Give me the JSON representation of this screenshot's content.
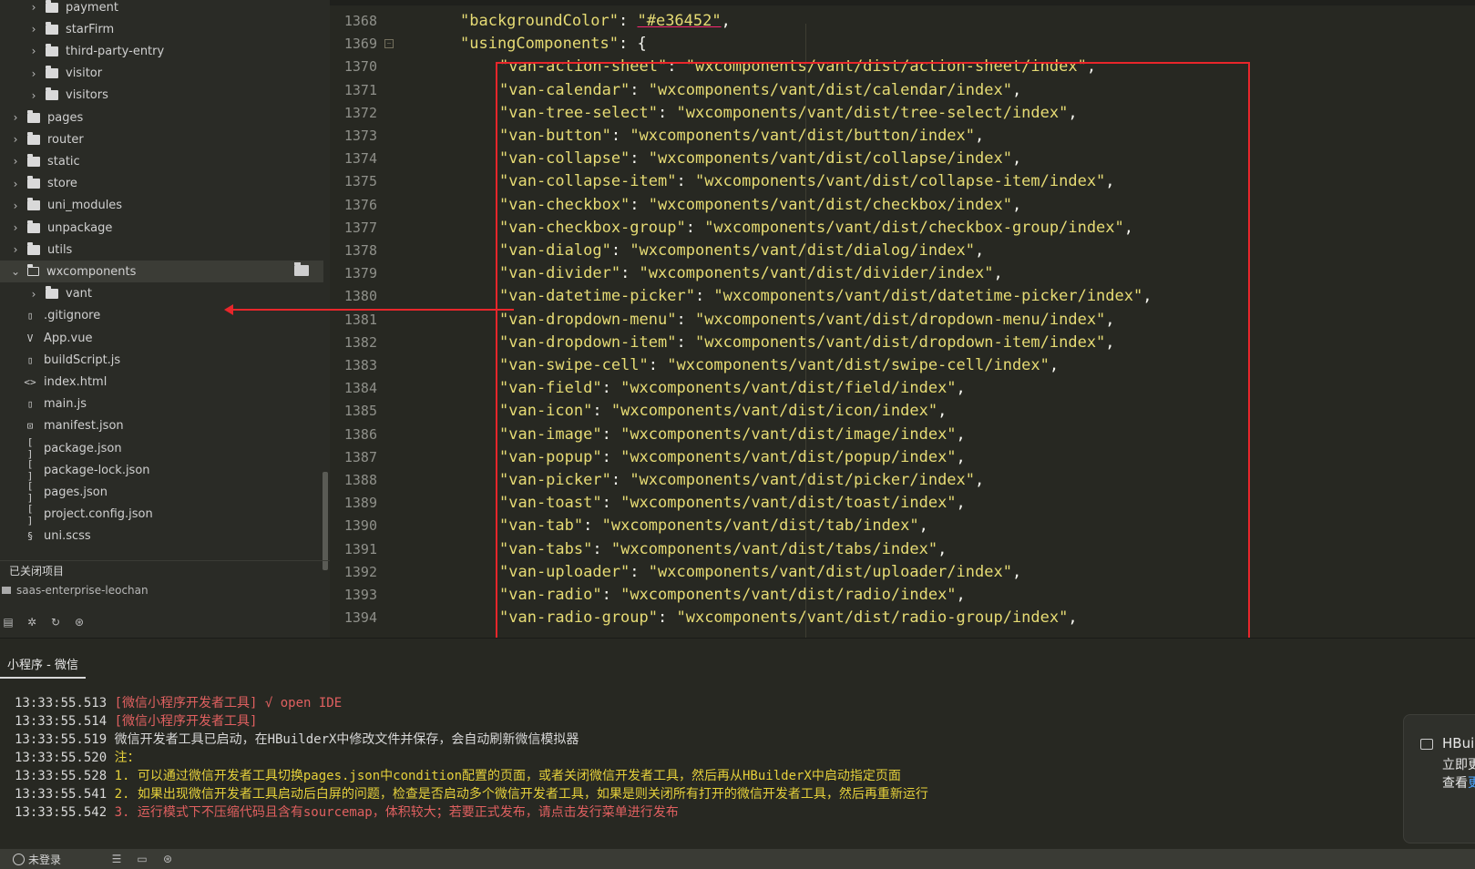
{
  "sidebar": {
    "tree": [
      {
        "label": "payment",
        "type": "folder",
        "indent": 1,
        "expanded": false
      },
      {
        "label": "starFirm",
        "type": "folder",
        "indent": 1,
        "expanded": false
      },
      {
        "label": "third-party-entry",
        "type": "folder",
        "indent": 1,
        "expanded": false
      },
      {
        "label": "visitor",
        "type": "folder",
        "indent": 1,
        "expanded": false
      },
      {
        "label": "visitors",
        "type": "folder",
        "indent": 1,
        "expanded": false
      },
      {
        "label": "pages",
        "type": "folder",
        "indent": 0,
        "expanded": false
      },
      {
        "label": "router",
        "type": "folder",
        "indent": 0,
        "expanded": false
      },
      {
        "label": "static",
        "type": "folder",
        "indent": 0,
        "expanded": false
      },
      {
        "label": "store",
        "type": "folder",
        "indent": 0,
        "expanded": false
      },
      {
        "label": "uni_modules",
        "type": "folder",
        "indent": 0,
        "expanded": false
      },
      {
        "label": "unpackage",
        "type": "folder",
        "indent": 0,
        "expanded": false
      },
      {
        "label": "utils",
        "type": "folder",
        "indent": 0,
        "expanded": false
      },
      {
        "label": "wxcomponents",
        "type": "folder",
        "indent": 0,
        "expanded": true,
        "selected": true
      },
      {
        "label": "vant",
        "type": "folder",
        "indent": 1,
        "expanded": false
      },
      {
        "label": ".gitignore",
        "type": "file",
        "icon": "file-icon",
        "indent": 0
      },
      {
        "label": "App.vue",
        "type": "file",
        "icon": "vue-file-icon",
        "indent": 0
      },
      {
        "label": "buildScript.js",
        "type": "file",
        "icon": "file-icon",
        "indent": 0
      },
      {
        "label": "index.html",
        "type": "file",
        "icon": "html-file-icon",
        "indent": 0
      },
      {
        "label": "main.js",
        "type": "file",
        "icon": "file-icon",
        "indent": 0
      },
      {
        "label": "manifest.json",
        "type": "file",
        "icon": "manifest-file-icon",
        "indent": 0
      },
      {
        "label": "package.json",
        "type": "file",
        "icon": "json-file-icon",
        "indent": 0
      },
      {
        "label": "package-lock.json",
        "type": "file",
        "icon": "json-file-icon",
        "indent": 0
      },
      {
        "label": "pages.json",
        "type": "file",
        "icon": "json-file-icon",
        "indent": 0
      },
      {
        "label": "project.config.json",
        "type": "file",
        "icon": "json-file-icon",
        "indent": 0
      },
      {
        "label": "uni.scss",
        "type": "file",
        "icon": "scss-file-icon",
        "indent": 0
      }
    ],
    "closed_header": "已关闭项目",
    "closed_project": "saas-enterprise-leochan"
  },
  "editor": {
    "lines": [
      {
        "n": "1368",
        "indent": "",
        "key": "\"backgroundColor\"",
        "sep": ": ",
        "val": "\"#e36452\"",
        "tail": ",",
        "underline": true
      },
      {
        "n": "1369",
        "indent": "",
        "key": "\"usingComponents\"",
        "sep": ": ",
        "val": "",
        "tail": "{",
        "fold": true
      },
      {
        "n": "1370",
        "indent": "    ",
        "key": "\"van-action-sheet\"",
        "sep": ": ",
        "val": "\"wxcomponents/vant/dist/action-sheet/index\"",
        "tail": ","
      },
      {
        "n": "1371",
        "indent": "    ",
        "key": "\"van-calendar\"",
        "sep": ": ",
        "val": "\"wxcomponents/vant/dist/calendar/index\"",
        "tail": ","
      },
      {
        "n": "1372",
        "indent": "    ",
        "key": "\"van-tree-select\"",
        "sep": ": ",
        "val": "\"wxcomponents/vant/dist/tree-select/index\"",
        "tail": ","
      },
      {
        "n": "1373",
        "indent": "    ",
        "key": "\"van-button\"",
        "sep": ": ",
        "val": "\"wxcomponents/vant/dist/button/index\"",
        "tail": ","
      },
      {
        "n": "1374",
        "indent": "    ",
        "key": "\"van-collapse\"",
        "sep": ": ",
        "val": "\"wxcomponents/vant/dist/collapse/index\"",
        "tail": ","
      },
      {
        "n": "1375",
        "indent": "    ",
        "key": "\"van-collapse-item\"",
        "sep": ": ",
        "val": "\"wxcomponents/vant/dist/collapse-item/index\"",
        "tail": ","
      },
      {
        "n": "1376",
        "indent": "    ",
        "key": "\"van-checkbox\"",
        "sep": ": ",
        "val": "\"wxcomponents/vant/dist/checkbox/index\"",
        "tail": ","
      },
      {
        "n": "1377",
        "indent": "    ",
        "key": "\"van-checkbox-group\"",
        "sep": ": ",
        "val": "\"wxcomponents/vant/dist/checkbox-group/index\"",
        "tail": ","
      },
      {
        "n": "1378",
        "indent": "    ",
        "key": "\"van-dialog\"",
        "sep": ": ",
        "val": "\"wxcomponents/vant/dist/dialog/index\"",
        "tail": ","
      },
      {
        "n": "1379",
        "indent": "    ",
        "key": "\"van-divider\"",
        "sep": ": ",
        "val": "\"wxcomponents/vant/dist/divider/index\"",
        "tail": ","
      },
      {
        "n": "1380",
        "indent": "    ",
        "key": "\"van-datetime-picker\"",
        "sep": ": ",
        "val": "\"wxcomponents/vant/dist/datetime-picker/index\"",
        "tail": ","
      },
      {
        "n": "1381",
        "indent": "    ",
        "key": "\"van-dropdown-menu\"",
        "sep": ": ",
        "val": "\"wxcomponents/vant/dist/dropdown-menu/index\"",
        "tail": ","
      },
      {
        "n": "1382",
        "indent": "    ",
        "key": "\"van-dropdown-item\"",
        "sep": ": ",
        "val": "\"wxcomponents/vant/dist/dropdown-item/index\"",
        "tail": ","
      },
      {
        "n": "1383",
        "indent": "    ",
        "key": "\"van-swipe-cell\"",
        "sep": ": ",
        "val": "\"wxcomponents/vant/dist/swipe-cell/index\"",
        "tail": ","
      },
      {
        "n": "1384",
        "indent": "    ",
        "key": "\"van-field\"",
        "sep": ": ",
        "val": "\"wxcomponents/vant/dist/field/index\"",
        "tail": ","
      },
      {
        "n": "1385",
        "indent": "    ",
        "key": "\"van-icon\"",
        "sep": ": ",
        "val": "\"wxcomponents/vant/dist/icon/index\"",
        "tail": ","
      },
      {
        "n": "1386",
        "indent": "    ",
        "key": "\"van-image\"",
        "sep": ": ",
        "val": "\"wxcomponents/vant/dist/image/index\"",
        "tail": ","
      },
      {
        "n": "1387",
        "indent": "    ",
        "key": "\"van-popup\"",
        "sep": ": ",
        "val": "\"wxcomponents/vant/dist/popup/index\"",
        "tail": ","
      },
      {
        "n": "1388",
        "indent": "    ",
        "key": "\"van-picker\"",
        "sep": ": ",
        "val": "\"wxcomponents/vant/dist/picker/index\"",
        "tail": ","
      },
      {
        "n": "1389",
        "indent": "    ",
        "key": "\"van-toast\"",
        "sep": ": ",
        "val": "\"wxcomponents/vant/dist/toast/index\"",
        "tail": ","
      },
      {
        "n": "1390",
        "indent": "    ",
        "key": "\"van-tab\"",
        "sep": ": ",
        "val": "\"wxcomponents/vant/dist/tab/index\"",
        "tail": ","
      },
      {
        "n": "1391",
        "indent": "    ",
        "key": "\"van-tabs\"",
        "sep": ": ",
        "val": "\"wxcomponents/vant/dist/tabs/index\"",
        "tail": ","
      },
      {
        "n": "1392",
        "indent": "    ",
        "key": "\"van-uploader\"",
        "sep": ": ",
        "val": "\"wxcomponents/vant/dist/uploader/index\"",
        "tail": ","
      },
      {
        "n": "1393",
        "indent": "    ",
        "key": "\"van-radio\"",
        "sep": ": ",
        "val": "\"wxcomponents/vant/dist/radio/index\"",
        "tail": ","
      },
      {
        "n": "1394",
        "indent": "    ",
        "key": "\"van-radio-group\"",
        "sep": ": ",
        "val": "\"wxcomponents/vant/dist/radio-group/index\"",
        "tail": ","
      }
    ]
  },
  "console": {
    "tab_label": "小程序 - 微信",
    "logs": [
      {
        "ts": "13:33:55.513",
        "msg": "[微信小程序开发者工具] √ open IDE",
        "color": "red"
      },
      {
        "ts": "13:33:55.514",
        "msg": "[微信小程序开发者工具]",
        "color": "red"
      },
      {
        "ts": "13:33:55.519",
        "msg": "微信开发者工具已启动，在HBuilderX中修改文件并保存，会自动刷新微信模拟器",
        "color": "white"
      },
      {
        "ts": "13:33:55.520",
        "msg": "注：",
        "color": "yellow"
      },
      {
        "ts": "13:33:55.528",
        "msg": "1. 可以通过微信开发者工具切换pages.json中condition配置的页面，或者关闭微信开发者工具，然后再从HBuilderX中启动指定页面",
        "color": "yellow"
      },
      {
        "ts": "13:33:55.541",
        "msg": "2. 如果出现微信开发者工具启动后白屏的问题，检查是否启动多个微信开发者工具，如果是则关闭所有打开的微信开发者工具，然后再重新运行",
        "color": "yellow"
      },
      {
        "ts": "13:33:55.542",
        "msg": "3. 运行模式下不压缩代码且含有sourcemap，体积较大；若要正式发布，请点击发行菜单进行发布",
        "color": "red"
      }
    ]
  },
  "notification": {
    "title": "HBuil",
    "line1": "立即更",
    "line2_prefix": "查看",
    "line2_link": "更"
  },
  "statusbar": {
    "login_label": "未登录"
  },
  "colors": {
    "editor_bg": "#272822",
    "highlight_box": "#e8262b",
    "string": "#e6db74",
    "console_red": "#e06060",
    "console_yellow": "#e6d13b"
  }
}
